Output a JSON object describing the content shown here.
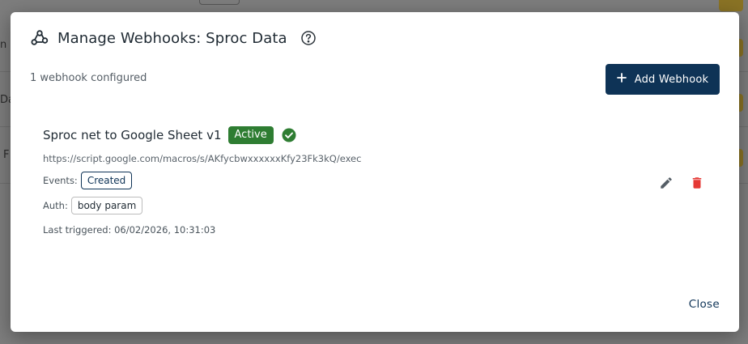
{
  "background": {
    "row_labels": [
      "n H",
      "Da",
      "F"
    ]
  },
  "modal": {
    "title": "Manage Webhooks: Sproc Data",
    "header_icon": "webhook-icon",
    "help_icon": "help-circle-icon",
    "count_text": "1 webhook configured",
    "add_button_label": "Add Webhook",
    "close_label": "Close"
  },
  "webhook": {
    "name": "Sproc net to Google Sheet v1",
    "status": "Active",
    "url": "https://script.google.com/macros/s/AKfycbwxxxxxxKfy23Fk3kQ/exec",
    "events_label": "Events:",
    "events": [
      "Created"
    ],
    "auth_label": "Auth:",
    "auth": "body param",
    "last_triggered": "Last triggered: 06/02/2026, 10:31:03"
  },
  "colors": {
    "primary": "#0e3356",
    "success": "#2e7d32",
    "danger": "#e53935"
  }
}
